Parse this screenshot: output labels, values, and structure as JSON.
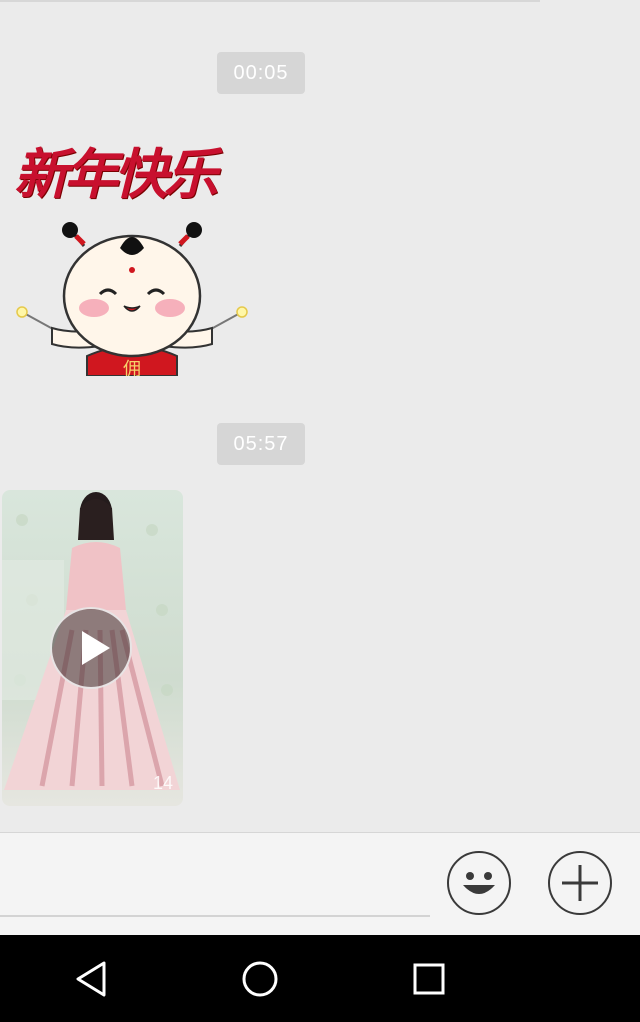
{
  "chat": {
    "messages": [
      {
        "type": "timestamp",
        "text": "00:05"
      },
      {
        "type": "sticker",
        "text": "新年快乐",
        "chest_text": "佣"
      },
      {
        "type": "timestamp",
        "text": "05:57"
      },
      {
        "type": "video",
        "duration": "14"
      }
    ]
  },
  "input_bar": {
    "emoji_icon": "smiley-face-icon",
    "plus_icon": "plus-icon"
  },
  "nav_bar": {
    "back_icon": "back-triangle-icon",
    "home_icon": "home-circle-icon",
    "recents_icon": "recents-square-icon"
  },
  "colors": {
    "chat_background": "#ebebeb",
    "timestamp_bg": "#d6d6d6",
    "sticker_red": "#c8102e",
    "nav_bar": "#000000"
  }
}
